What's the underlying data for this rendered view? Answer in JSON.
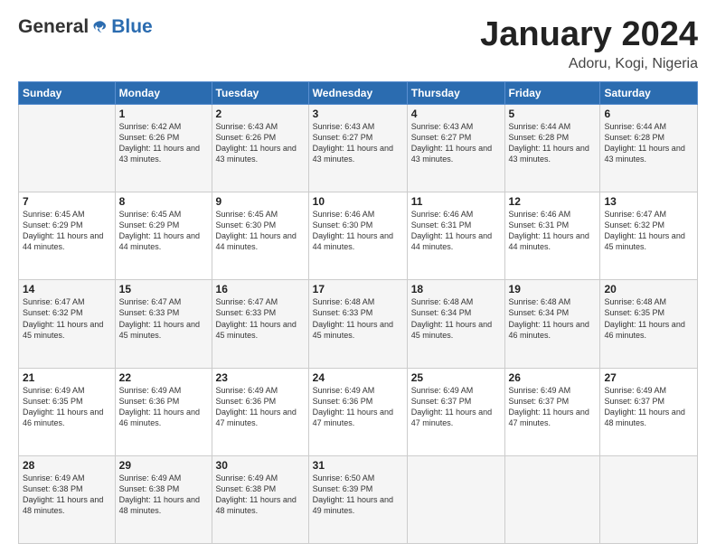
{
  "logo": {
    "general": "General",
    "blue": "Blue"
  },
  "header": {
    "month": "January 2024",
    "location": "Adoru, Kogi, Nigeria"
  },
  "weekdays": [
    "Sunday",
    "Monday",
    "Tuesday",
    "Wednesday",
    "Thursday",
    "Friday",
    "Saturday"
  ],
  "weeks": [
    [
      {
        "day": "",
        "sunrise": "",
        "sunset": "",
        "daylight": ""
      },
      {
        "day": "1",
        "sunrise": "Sunrise: 6:42 AM",
        "sunset": "Sunset: 6:26 PM",
        "daylight": "Daylight: 11 hours and 43 minutes."
      },
      {
        "day": "2",
        "sunrise": "Sunrise: 6:43 AM",
        "sunset": "Sunset: 6:26 PM",
        "daylight": "Daylight: 11 hours and 43 minutes."
      },
      {
        "day": "3",
        "sunrise": "Sunrise: 6:43 AM",
        "sunset": "Sunset: 6:27 PM",
        "daylight": "Daylight: 11 hours and 43 minutes."
      },
      {
        "day": "4",
        "sunrise": "Sunrise: 6:43 AM",
        "sunset": "Sunset: 6:27 PM",
        "daylight": "Daylight: 11 hours and 43 minutes."
      },
      {
        "day": "5",
        "sunrise": "Sunrise: 6:44 AM",
        "sunset": "Sunset: 6:28 PM",
        "daylight": "Daylight: 11 hours and 43 minutes."
      },
      {
        "day": "6",
        "sunrise": "Sunrise: 6:44 AM",
        "sunset": "Sunset: 6:28 PM",
        "daylight": "Daylight: 11 hours and 43 minutes."
      }
    ],
    [
      {
        "day": "7",
        "sunrise": "Sunrise: 6:45 AM",
        "sunset": "Sunset: 6:29 PM",
        "daylight": "Daylight: 11 hours and 44 minutes."
      },
      {
        "day": "8",
        "sunrise": "Sunrise: 6:45 AM",
        "sunset": "Sunset: 6:29 PM",
        "daylight": "Daylight: 11 hours and 44 minutes."
      },
      {
        "day": "9",
        "sunrise": "Sunrise: 6:45 AM",
        "sunset": "Sunset: 6:30 PM",
        "daylight": "Daylight: 11 hours and 44 minutes."
      },
      {
        "day": "10",
        "sunrise": "Sunrise: 6:46 AM",
        "sunset": "Sunset: 6:30 PM",
        "daylight": "Daylight: 11 hours and 44 minutes."
      },
      {
        "day": "11",
        "sunrise": "Sunrise: 6:46 AM",
        "sunset": "Sunset: 6:31 PM",
        "daylight": "Daylight: 11 hours and 44 minutes."
      },
      {
        "day": "12",
        "sunrise": "Sunrise: 6:46 AM",
        "sunset": "Sunset: 6:31 PM",
        "daylight": "Daylight: 11 hours and 44 minutes."
      },
      {
        "day": "13",
        "sunrise": "Sunrise: 6:47 AM",
        "sunset": "Sunset: 6:32 PM",
        "daylight": "Daylight: 11 hours and 45 minutes."
      }
    ],
    [
      {
        "day": "14",
        "sunrise": "Sunrise: 6:47 AM",
        "sunset": "Sunset: 6:32 PM",
        "daylight": "Daylight: 11 hours and 45 minutes."
      },
      {
        "day": "15",
        "sunrise": "Sunrise: 6:47 AM",
        "sunset": "Sunset: 6:33 PM",
        "daylight": "Daylight: 11 hours and 45 minutes."
      },
      {
        "day": "16",
        "sunrise": "Sunrise: 6:47 AM",
        "sunset": "Sunset: 6:33 PM",
        "daylight": "Daylight: 11 hours and 45 minutes."
      },
      {
        "day": "17",
        "sunrise": "Sunrise: 6:48 AM",
        "sunset": "Sunset: 6:33 PM",
        "daylight": "Daylight: 11 hours and 45 minutes."
      },
      {
        "day": "18",
        "sunrise": "Sunrise: 6:48 AM",
        "sunset": "Sunset: 6:34 PM",
        "daylight": "Daylight: 11 hours and 45 minutes."
      },
      {
        "day": "19",
        "sunrise": "Sunrise: 6:48 AM",
        "sunset": "Sunset: 6:34 PM",
        "daylight": "Daylight: 11 hours and 46 minutes."
      },
      {
        "day": "20",
        "sunrise": "Sunrise: 6:48 AM",
        "sunset": "Sunset: 6:35 PM",
        "daylight": "Daylight: 11 hours and 46 minutes."
      }
    ],
    [
      {
        "day": "21",
        "sunrise": "Sunrise: 6:49 AM",
        "sunset": "Sunset: 6:35 PM",
        "daylight": "Daylight: 11 hours and 46 minutes."
      },
      {
        "day": "22",
        "sunrise": "Sunrise: 6:49 AM",
        "sunset": "Sunset: 6:36 PM",
        "daylight": "Daylight: 11 hours and 46 minutes."
      },
      {
        "day": "23",
        "sunrise": "Sunrise: 6:49 AM",
        "sunset": "Sunset: 6:36 PM",
        "daylight": "Daylight: 11 hours and 47 minutes."
      },
      {
        "day": "24",
        "sunrise": "Sunrise: 6:49 AM",
        "sunset": "Sunset: 6:36 PM",
        "daylight": "Daylight: 11 hours and 47 minutes."
      },
      {
        "day": "25",
        "sunrise": "Sunrise: 6:49 AM",
        "sunset": "Sunset: 6:37 PM",
        "daylight": "Daylight: 11 hours and 47 minutes."
      },
      {
        "day": "26",
        "sunrise": "Sunrise: 6:49 AM",
        "sunset": "Sunset: 6:37 PM",
        "daylight": "Daylight: 11 hours and 47 minutes."
      },
      {
        "day": "27",
        "sunrise": "Sunrise: 6:49 AM",
        "sunset": "Sunset: 6:37 PM",
        "daylight": "Daylight: 11 hours and 48 minutes."
      }
    ],
    [
      {
        "day": "28",
        "sunrise": "Sunrise: 6:49 AM",
        "sunset": "Sunset: 6:38 PM",
        "daylight": "Daylight: 11 hours and 48 minutes."
      },
      {
        "day": "29",
        "sunrise": "Sunrise: 6:49 AM",
        "sunset": "Sunset: 6:38 PM",
        "daylight": "Daylight: 11 hours and 48 minutes."
      },
      {
        "day": "30",
        "sunrise": "Sunrise: 6:49 AM",
        "sunset": "Sunset: 6:38 PM",
        "daylight": "Daylight: 11 hours and 48 minutes."
      },
      {
        "day": "31",
        "sunrise": "Sunrise: 6:50 AM",
        "sunset": "Sunset: 6:39 PM",
        "daylight": "Daylight: 11 hours and 49 minutes."
      },
      {
        "day": "",
        "sunrise": "",
        "sunset": "",
        "daylight": ""
      },
      {
        "day": "",
        "sunrise": "",
        "sunset": "",
        "daylight": ""
      },
      {
        "day": "",
        "sunrise": "",
        "sunset": "",
        "daylight": ""
      }
    ]
  ]
}
